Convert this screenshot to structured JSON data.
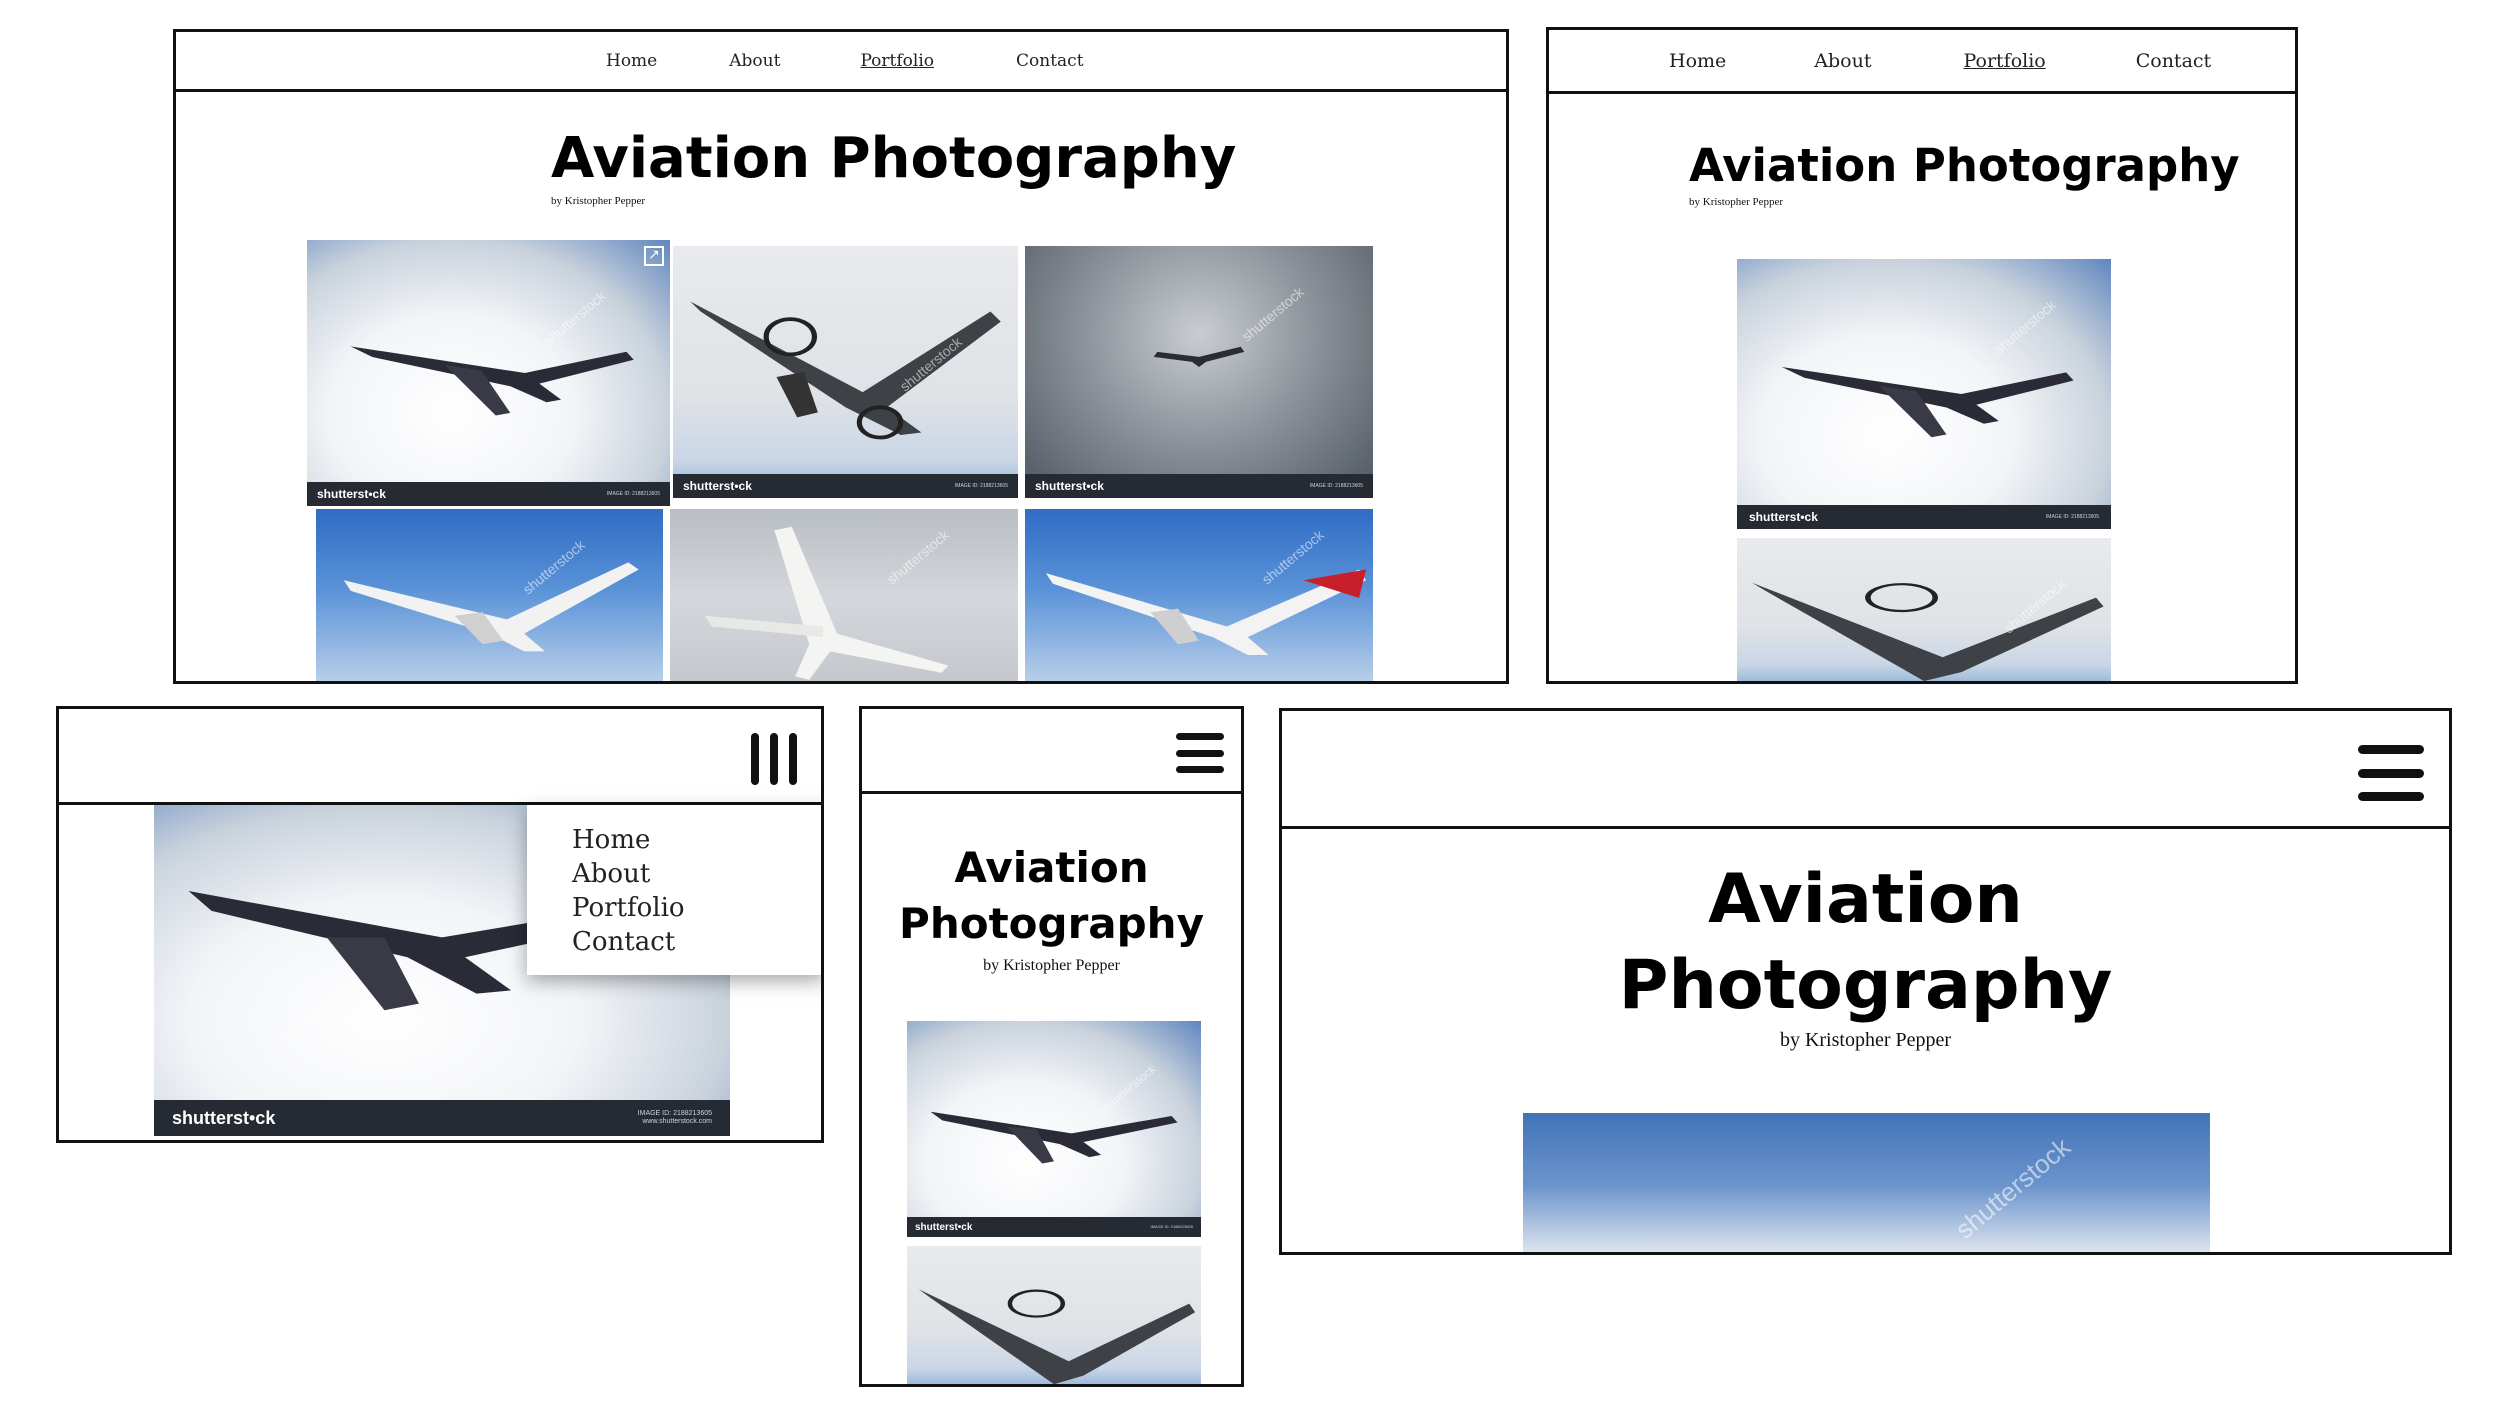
{
  "nav": {
    "home": "Home",
    "about": "About",
    "portfolio": "Portfolio",
    "contact": "Contact"
  },
  "page": {
    "title": "Aviation Photography",
    "title_line1": "Aviation",
    "title_line2": "Photography",
    "byline": "by Kristopher Pepper"
  },
  "watermark": {
    "brand": "shutterstock",
    "brand_short": "shutterst•ck",
    "image_id": "IMAGE ID: 2188213605",
    "site": "www.shutterstock.com",
    "overlay": "shutterstock"
  },
  "icons": {
    "menu": "hamburger-menu-icon",
    "menu_open": "menu-open-bars-icon",
    "external": "external-link-icon"
  },
  "colors": {
    "border": "#111111",
    "strip": "#262a33",
    "nordic_red": "#c8202b"
  }
}
